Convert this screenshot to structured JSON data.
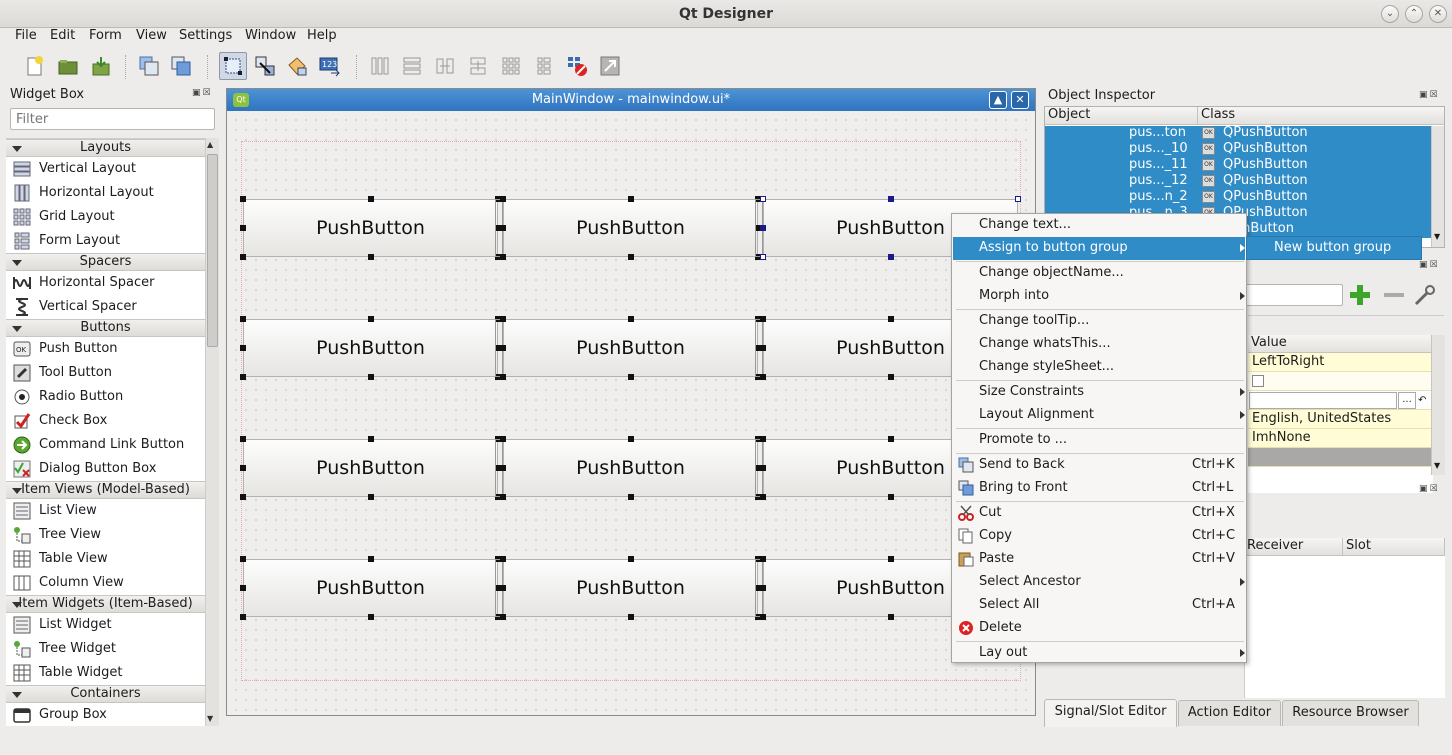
{
  "app_title": "Qt Designer",
  "menu": [
    "File",
    "Edit",
    "Form",
    "View",
    "Settings",
    "Window",
    "Help"
  ],
  "widget_box": {
    "title": "Widget Box",
    "filter_placeholder": "Filter",
    "categories": [
      {
        "name": "Layouts",
        "items": [
          "Vertical Layout",
          "Horizontal Layout",
          "Grid Layout",
          "Form Layout"
        ]
      },
      {
        "name": "Spacers",
        "items": [
          "Horizontal Spacer",
          "Vertical Spacer"
        ]
      },
      {
        "name": "Buttons",
        "items": [
          "Push Button",
          "Tool Button",
          "Radio Button",
          "Check Box",
          "Command Link Button",
          "Dialog Button Box"
        ]
      },
      {
        "name": "Item Views (Model-Based)",
        "items": [
          "List View",
          "Tree View",
          "Table View",
          "Column View"
        ]
      },
      {
        "name": "Item Widgets (Item-Based)",
        "items": [
          "List Widget",
          "Tree Widget",
          "Table Widget"
        ]
      },
      {
        "name": "Containers",
        "items": [
          "Group Box"
        ]
      }
    ]
  },
  "form": {
    "title": "MainWindow - mainwindow.ui*",
    "button_label": "PushButton"
  },
  "object_inspector": {
    "title": "Object Inspector",
    "col_object": "Object",
    "col_class": "Class",
    "rows": [
      {
        "object": "pus...ton",
        "class": "QPushButton"
      },
      {
        "object": "pus..._10",
        "class": "QPushButton"
      },
      {
        "object": "pus..._11",
        "class": "QPushButton"
      },
      {
        "object": "pus..._12",
        "class": "QPushButton"
      },
      {
        "object": "pus...n_2",
        "class": "QPushButton"
      },
      {
        "object": "pus...n_3",
        "class": "QPushButton"
      },
      {
        "object": "",
        "class": "...shButton"
      }
    ]
  },
  "property_editor": {
    "col_value": "Value",
    "values": [
      "LeftToRight",
      "",
      "",
      "English, UnitedStates",
      "ImhNone",
      ""
    ]
  },
  "signal_slot": {
    "col_receiver": "Receiver",
    "col_slot": "Slot"
  },
  "bottom_tabs": [
    "Signal/Slot Editor",
    "Action Editor",
    "Resource Browser"
  ],
  "context_menu": {
    "items": [
      {
        "label": "Change text...",
        "shortcut": "",
        "submenu": false
      },
      {
        "label": "Assign to button group",
        "shortcut": "",
        "submenu": true,
        "highlighted": true
      },
      {
        "label": "Change objectName...",
        "shortcut": "",
        "submenu": false
      },
      {
        "label": "Morph into",
        "shortcut": "",
        "submenu": true
      },
      {
        "label": "Change toolTip...",
        "shortcut": "",
        "submenu": false
      },
      {
        "label": "Change whatsThis...",
        "shortcut": "",
        "submenu": false
      },
      {
        "label": "Change styleSheet...",
        "shortcut": "",
        "submenu": false
      },
      {
        "label": "Size Constraints",
        "shortcut": "",
        "submenu": true
      },
      {
        "label": "Layout Alignment",
        "shortcut": "",
        "submenu": true
      },
      {
        "label": "Promote to ...",
        "shortcut": "",
        "submenu": false
      },
      {
        "label": "Send to Back",
        "shortcut": "Ctrl+K",
        "submenu": false
      },
      {
        "label": "Bring to Front",
        "shortcut": "Ctrl+L",
        "submenu": false
      },
      {
        "label": "Cut",
        "shortcut": "Ctrl+X",
        "submenu": false
      },
      {
        "label": "Copy",
        "shortcut": "Ctrl+C",
        "submenu": false
      },
      {
        "label": "Paste",
        "shortcut": "Ctrl+V",
        "submenu": false
      },
      {
        "label": "Select Ancestor",
        "shortcut": "",
        "submenu": true
      },
      {
        "label": "Select All",
        "shortcut": "Ctrl+A",
        "submenu": false
      },
      {
        "label": "Delete",
        "shortcut": "",
        "submenu": false
      },
      {
        "label": "Lay out",
        "shortcut": "",
        "submenu": true
      }
    ],
    "submenu_item": "New button group"
  }
}
